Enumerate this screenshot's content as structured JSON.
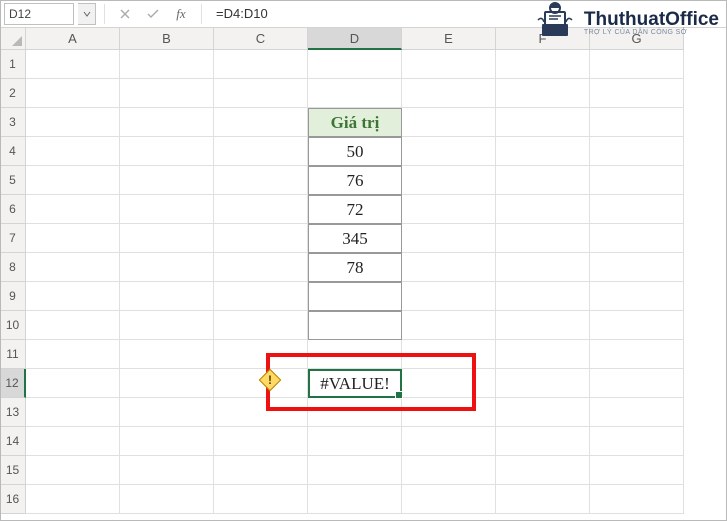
{
  "name_box": "D12",
  "formula": "=D4:D10",
  "columns": [
    "A",
    "B",
    "C",
    "D",
    "E",
    "F",
    "G"
  ],
  "rows": [
    "1",
    "2",
    "3",
    "4",
    "5",
    "6",
    "7",
    "8",
    "9",
    "10",
    "11",
    "12",
    "13",
    "14",
    "15",
    "16"
  ],
  "table": {
    "header": "Giá trị",
    "values": [
      "50",
      "76",
      "72",
      "345",
      "78"
    ]
  },
  "error_cell": "#VALUE!",
  "error_glyph": "!",
  "logo": {
    "name": "ThuthuatOffice",
    "tag": "TRỢ LÝ CỦA DÂN CÔNG SỞ"
  },
  "selected": {
    "col_index": 3,
    "row_index": 11
  }
}
